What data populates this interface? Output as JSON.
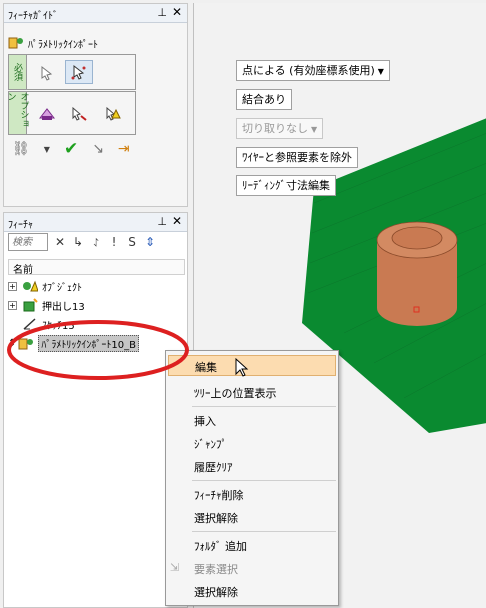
{
  "guide_panel": {
    "title": "ﾌｨｰﾁｬｶﾞｲﾄﾞ",
    "command_label": "ﾊﾟﾗﾒﾄﾘｯｸｲﾝﾎﾟｰﾄ",
    "required_tab": "必須",
    "option_tab": "オプション"
  },
  "feature_panel": {
    "title": "ﾌｨｰﾁｬ",
    "search_placeholder": "検索",
    "filter_s_label": "S",
    "column_header": "名前",
    "tree": [
      {
        "label": "ｵﾌﾞｼﾞｪｸﾄ",
        "expander": "+"
      },
      {
        "label": "押出し13",
        "expander": "+"
      },
      {
        "label": "ｽｹｯﾁ15",
        "expander": ""
      },
      {
        "label": "ﾊﾟﾗﾒﾄﾘｯｸｲﾝﾎﾟｰﾄ10_B",
        "expander": "+"
      }
    ]
  },
  "viewport": {
    "buttons": [
      {
        "label": "点による (有効座標系使用)",
        "has_dropdown": true,
        "disabled": false
      },
      {
        "label": "結合あり",
        "has_dropdown": false,
        "disabled": false
      },
      {
        "label": "切り取りなし",
        "has_dropdown": true,
        "disabled": true
      },
      {
        "label": "ﾜｲﾔｰと参照要素を除外",
        "has_dropdown": false,
        "disabled": false
      },
      {
        "label": "ﾘｰﾃﾞｨﾝｸﾞ寸法編集",
        "has_dropdown": false,
        "disabled": false
      }
    ],
    "plate_color": "#0a8a30",
    "cylinder_color": "#c97a52"
  },
  "context_menu": {
    "items": [
      {
        "label": "編集"
      },
      {
        "label": "ﾂﾘｰ上の位置表示"
      },
      {
        "label": "挿入"
      },
      {
        "label": "ｼﾞｬﾝﾌﾟ"
      },
      {
        "label": "履歴ｸﾘｱ"
      },
      {
        "label": "ﾌｨｰﾁｬ削除"
      },
      {
        "label": "選択解除"
      },
      {
        "label": "ﾌｫﾙﾀﾞ 追加"
      },
      {
        "label": "要素選択"
      },
      {
        "label": "選択解除"
      }
    ]
  },
  "annotation": {
    "color": "#dd2020"
  }
}
